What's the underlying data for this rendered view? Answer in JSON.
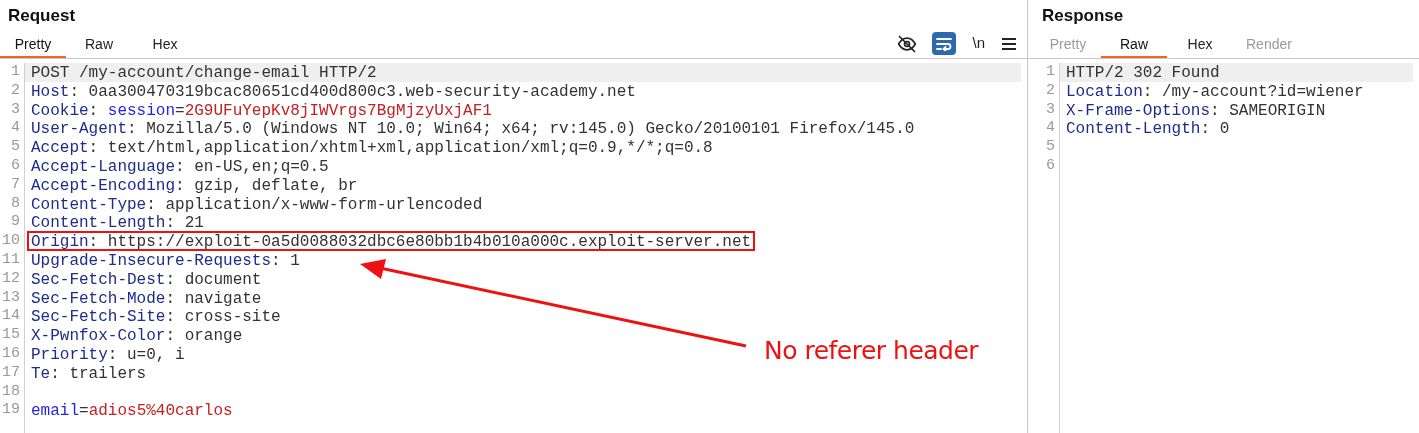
{
  "request": {
    "title": "Request",
    "tabs": [
      {
        "label": "Pretty",
        "selected": true,
        "disabled": false
      },
      {
        "label": "Raw",
        "selected": false,
        "disabled": false
      },
      {
        "label": "Hex",
        "selected": false,
        "disabled": false
      }
    ],
    "toolbar": {
      "newline_label": "\\n",
      "wrap_active": true
    },
    "lines": [
      {
        "number": "1",
        "current": true,
        "boxed": false,
        "segments": [
          {
            "text": "POST /my-account/change-email HTTP/2",
            "kind": "plain"
          }
        ]
      },
      {
        "number": "2",
        "current": false,
        "boxed": false,
        "segments": [
          {
            "text": "Host",
            "kind": "name"
          },
          {
            "text": ": 0aa300470319bcac80651cd400d800c3.web-security-academy.net",
            "kind": "plain"
          }
        ]
      },
      {
        "number": "3",
        "current": false,
        "boxed": false,
        "segments": [
          {
            "text": "Cookie",
            "kind": "name"
          },
          {
            "text": ": ",
            "kind": "plain"
          },
          {
            "text": "session",
            "kind": "param"
          },
          {
            "text": "=",
            "kind": "plain"
          },
          {
            "text": "2G9UFuYepKv8jIWVrgs7BgMjzyUxjAF1",
            "kind": "value"
          }
        ]
      },
      {
        "number": "4",
        "current": false,
        "boxed": false,
        "segments": [
          {
            "text": "User-Agent",
            "kind": "name"
          },
          {
            "text": ": Mozilla/5.0 (Windows NT 10.0; Win64; x64; rv:145.0) Gecko/20100101 Firefox/145.0",
            "kind": "plain"
          }
        ]
      },
      {
        "number": "5",
        "current": false,
        "boxed": false,
        "segments": [
          {
            "text": "Accept",
            "kind": "name"
          },
          {
            "text": ": text/html,application/xhtml+xml,application/xml;q=0.9,*/*;q=0.8",
            "kind": "plain"
          }
        ]
      },
      {
        "number": "6",
        "current": false,
        "boxed": false,
        "segments": [
          {
            "text": "Accept-Language",
            "kind": "name"
          },
          {
            "text": ": en-US,en;q=0.5",
            "kind": "plain"
          }
        ]
      },
      {
        "number": "7",
        "current": false,
        "boxed": false,
        "segments": [
          {
            "text": "Accept-Encoding",
            "kind": "name"
          },
          {
            "text": ": gzip, deflate, br",
            "kind": "plain"
          }
        ]
      },
      {
        "number": "8",
        "current": false,
        "boxed": false,
        "segments": [
          {
            "text": "Content-Type",
            "kind": "name"
          },
          {
            "text": ": application/x-www-form-urlencoded",
            "kind": "plain"
          }
        ]
      },
      {
        "number": "9",
        "current": false,
        "boxed": false,
        "segments": [
          {
            "text": "Content-Length",
            "kind": "name"
          },
          {
            "text": ": 21",
            "kind": "plain"
          }
        ]
      },
      {
        "number": "10",
        "current": false,
        "boxed": true,
        "segments": [
          {
            "text": "Origin",
            "kind": "name"
          },
          {
            "text": ": https://exploit-0a5d0088032dbc6e80bb1b4b010a000c.exploit-server.net",
            "kind": "plain"
          }
        ]
      },
      {
        "number": "11",
        "current": false,
        "boxed": false,
        "segments": [
          {
            "text": "Upgrade-Insecure-Requests",
            "kind": "name"
          },
          {
            "text": ": 1",
            "kind": "plain"
          }
        ]
      },
      {
        "number": "12",
        "current": false,
        "boxed": false,
        "segments": [
          {
            "text": "Sec-Fetch-Dest",
            "kind": "name"
          },
          {
            "text": ": document",
            "kind": "plain"
          }
        ]
      },
      {
        "number": "13",
        "current": false,
        "boxed": false,
        "segments": [
          {
            "text": "Sec-Fetch-Mode",
            "kind": "name"
          },
          {
            "text": ": navigate",
            "kind": "plain"
          }
        ]
      },
      {
        "number": "14",
        "current": false,
        "boxed": false,
        "segments": [
          {
            "text": "Sec-Fetch-Site",
            "kind": "name"
          },
          {
            "text": ": cross-site",
            "kind": "plain"
          }
        ]
      },
      {
        "number": "15",
        "current": false,
        "boxed": false,
        "segments": [
          {
            "text": "X-Pwnfox-Color",
            "kind": "name"
          },
          {
            "text": ": orange",
            "kind": "plain"
          }
        ]
      },
      {
        "number": "16",
        "current": false,
        "boxed": false,
        "segments": [
          {
            "text": "Priority",
            "kind": "name"
          },
          {
            "text": ": u=0, i",
            "kind": "plain"
          }
        ]
      },
      {
        "number": "17",
        "current": false,
        "boxed": false,
        "segments": [
          {
            "text": "Te",
            "kind": "name"
          },
          {
            "text": ": trailers",
            "kind": "plain"
          }
        ]
      },
      {
        "number": "18",
        "current": false
      },
      {
        "number": "19",
        "current": false,
        "boxed": false,
        "segments": [
          {
            "text": "email",
            "kind": "param"
          },
          {
            "text": "=",
            "kind": "plain"
          },
          {
            "text": "adios5%40carlos",
            "kind": "value"
          }
        ]
      }
    ]
  },
  "response": {
    "title": "Response",
    "tabs": [
      {
        "label": "Pretty",
        "selected": false,
        "disabled": true
      },
      {
        "label": "Raw",
        "selected": true,
        "disabled": false
      },
      {
        "label": "Hex",
        "selected": false,
        "disabled": false
      },
      {
        "label": "Render",
        "selected": false,
        "disabled": true
      }
    ],
    "lines": [
      {
        "number": "1",
        "current": true,
        "boxed": false,
        "segments": [
          {
            "text": "HTTP/2 302 Found",
            "kind": "plain"
          }
        ]
      },
      {
        "number": "2",
        "current": false,
        "boxed": false,
        "segments": [
          {
            "text": "Location",
            "kind": "name"
          },
          {
            "text": ": /my-account?id=wiener",
            "kind": "plain"
          }
        ]
      },
      {
        "number": "3",
        "current": false,
        "boxed": false,
        "segments": [
          {
            "text": "X-Frame-Options",
            "kind": "name"
          },
          {
            "text": ": SAMEORIGIN",
            "kind": "plain"
          }
        ]
      },
      {
        "number": "4",
        "current": false,
        "boxed": false,
        "segments": [
          {
            "text": "Content-Length",
            "kind": "name"
          },
          {
            "text": ": 0",
            "kind": "plain"
          }
        ]
      },
      {
        "number": "5",
        "current": false
      },
      {
        "number": "6",
        "current": false
      }
    ]
  },
  "annotation": {
    "text": "No referer header"
  }
}
